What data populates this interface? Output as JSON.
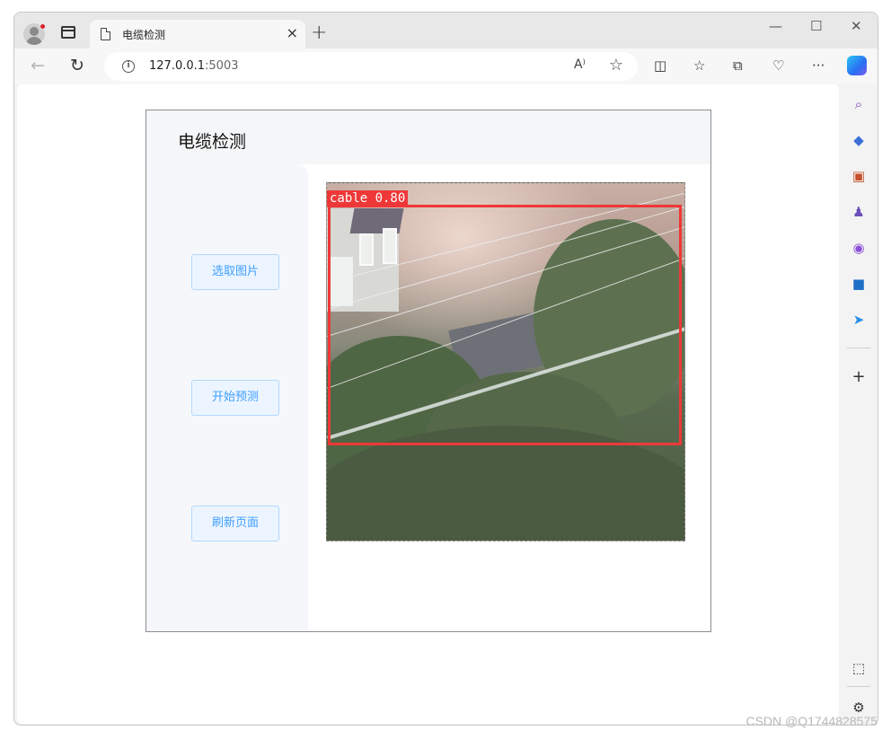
{
  "browser": {
    "tab_title": "电缆检测",
    "url_host": "127.0.0.1",
    "url_port": ":5003",
    "new_tab": "+",
    "close_tab": "×",
    "min": "—",
    "max": "☐",
    "close": "✕"
  },
  "toolbar_icons": [
    "back-icon",
    "refresh-icon",
    "split-screen-icon",
    "favorites-icon",
    "collections-icon",
    "browser-essentials-icon",
    "more-icon",
    "copilot-icon"
  ],
  "sidebar_icons": [
    "search-icon",
    "shopping-icon",
    "tools-icon",
    "games-icon",
    "microsoft365-icon",
    "outlook-icon",
    "drop-icon",
    "add-icon",
    "screenshot-icon",
    "settings-icon"
  ],
  "app": {
    "title": "电缆检测",
    "buttons": {
      "select_image": "选取图片",
      "start_predict": "开始预测",
      "refresh_page": "刷新页面"
    },
    "detection": {
      "label": "cable 0.80",
      "color": "#ee3838"
    }
  },
  "watermark": "CSDN @Q1744828575"
}
